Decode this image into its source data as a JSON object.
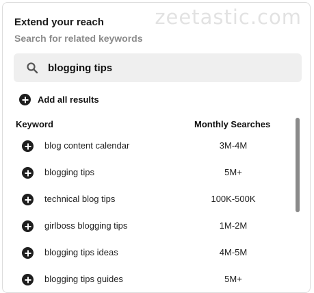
{
  "header": {
    "title": "Extend your reach",
    "subtitle": "Search for related keywords",
    "watermark": "zeetastic.com"
  },
  "search": {
    "value": "blogging tips",
    "icon": "search-icon"
  },
  "add_all_label": "Add all results",
  "table": {
    "columns": [
      "Keyword",
      "Monthly Searches"
    ],
    "rows": [
      {
        "keyword": "blog content calendar",
        "searches": "3M-4M"
      },
      {
        "keyword": "blogging tips",
        "searches": "5M+"
      },
      {
        "keyword": "technical blog tips",
        "searches": "100K-500K"
      },
      {
        "keyword": "girlboss blogging tips",
        "searches": "1M-2M"
      },
      {
        "keyword": "blogging tips ideas",
        "searches": "4M-5M"
      },
      {
        "keyword": "blogging tips guides",
        "searches": "5M+"
      }
    ]
  },
  "colors": {
    "accent": "#1e1e1e",
    "search_bg": "#efefef",
    "muted_text": "#8b8b8b",
    "scrollbar": "#8a8a8a"
  }
}
